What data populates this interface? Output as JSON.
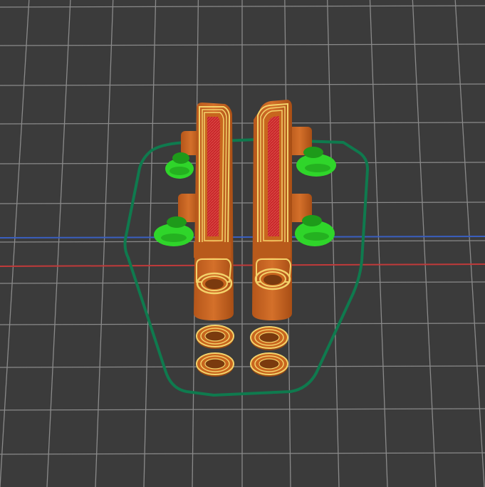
{
  "viewport": {
    "background": "#3b3b3b",
    "grid_color": "#8a8a8a",
    "axis_x_color": "#c03a3a",
    "axis_y_color": "#3a5fc0"
  },
  "colors": {
    "skirt": "#0f7a4e",
    "part_wall": "#c8651e",
    "part_wall_dark": "#9c4a12",
    "perimeter": "#f3d26a",
    "infill": "#c9262a",
    "support": "#2fd52a",
    "support_dark": "#1e9a1a"
  },
  "objects": [
    {
      "name": "left-arm-part"
    },
    {
      "name": "right-arm-part"
    },
    {
      "name": "washer-1"
    },
    {
      "name": "washer-2"
    },
    {
      "name": "washer-3"
    },
    {
      "name": "washer-4"
    }
  ]
}
